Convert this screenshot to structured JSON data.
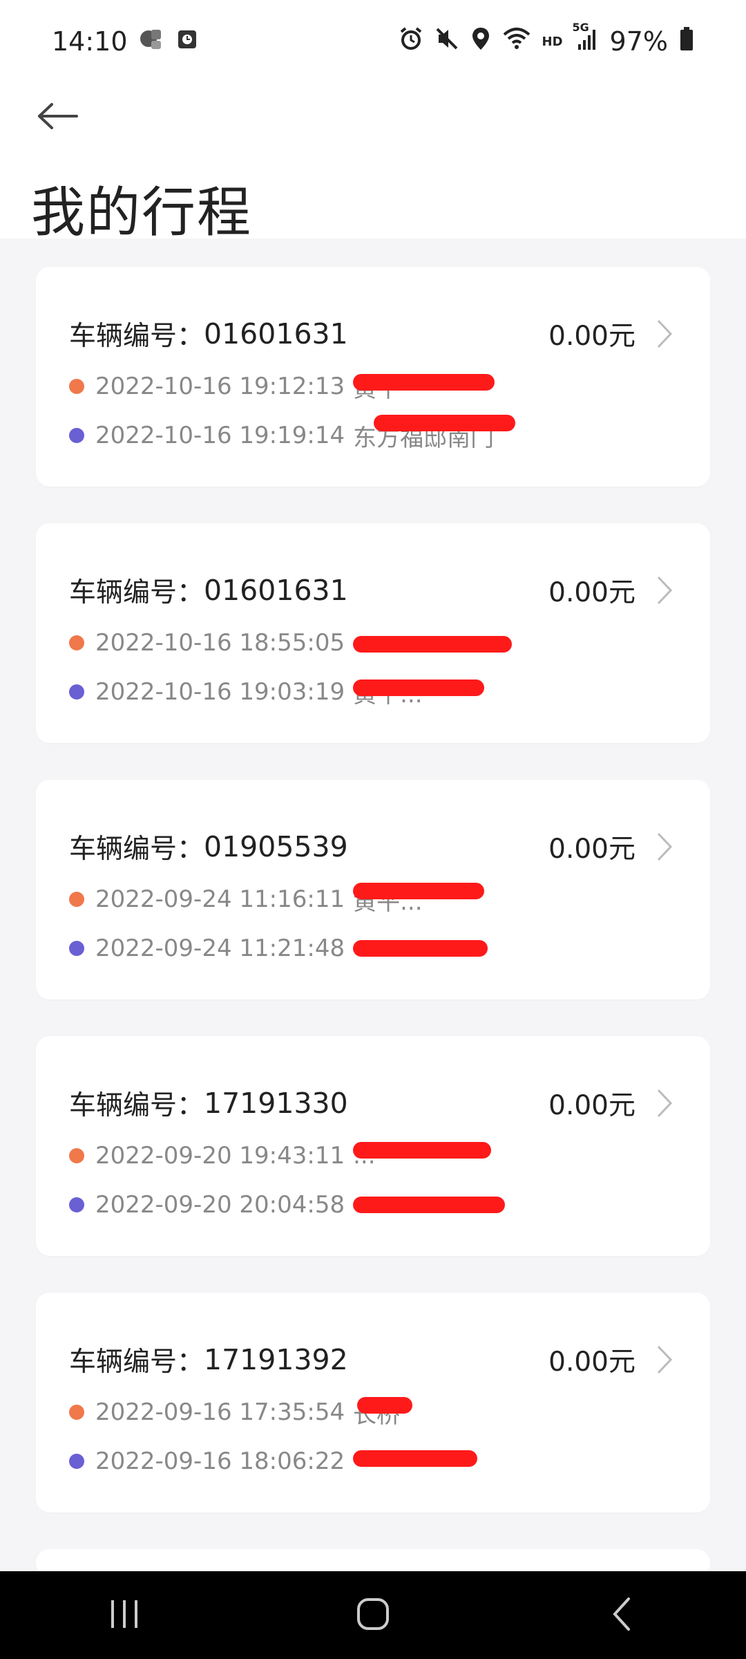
{
  "status": {
    "time": "14:10",
    "battery": "97%",
    "network": "5G",
    "hd": "HD"
  },
  "page": {
    "title": "我的行程"
  },
  "trips": [
    {
      "vehicle_label": "车辆编号：",
      "vehicle_no": "01601631",
      "amount": "0.00元",
      "start_time": "2022-10-16 19:12:13",
      "start_place": "黄平",
      "end_time": "2022-10-16 19:19:14",
      "end_place": "东方福邸南门"
    },
    {
      "vehicle_label": "车辆编号：",
      "vehicle_no": "01601631",
      "amount": "0.00元",
      "start_time": "2022-10-16 18:55:05",
      "start_place": "",
      "end_time": "2022-10-16 19:03:19",
      "end_place": "黄平..."
    },
    {
      "vehicle_label": "车辆编号：",
      "vehicle_no": "01905539",
      "amount": "0.00元",
      "start_time": "2022-09-24 11:16:11",
      "start_place": "黄平...",
      "end_time": "2022-09-24 11:21:48",
      "end_place": ""
    },
    {
      "vehicle_label": "车辆编号：",
      "vehicle_no": "17191330",
      "amount": "0.00元",
      "start_time": "2022-09-20 19:43:11",
      "start_place": "...",
      "end_time": "2022-09-20 20:04:58",
      "end_place": ""
    },
    {
      "vehicle_label": "车辆编号：",
      "vehicle_no": "17191392",
      "amount": "0.00元",
      "start_time": "2022-09-16 17:35:54",
      "start_place": "长桥",
      "end_time": "2022-09-16 18:06:22",
      "end_place": ""
    }
  ],
  "colors": {
    "start_dot": "#f0784a",
    "end_dot": "#6a5fd3",
    "redaction": "#ff1a1a"
  },
  "icons": {
    "back": "arrow-left-icon",
    "chevron": "chevron-right-icon"
  }
}
